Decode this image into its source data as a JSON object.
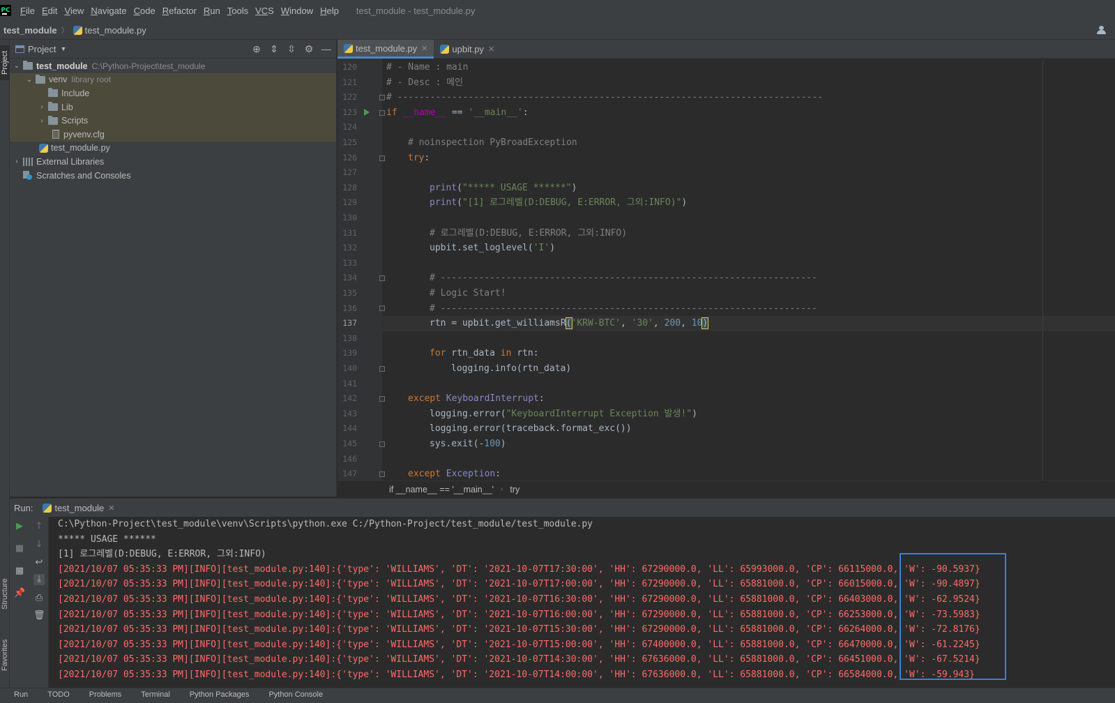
{
  "menu": {
    "logo": "PC",
    "items": [
      {
        "key": "F",
        "rest": "ile"
      },
      {
        "key": "E",
        "rest": "dit"
      },
      {
        "key": "V",
        "rest": "iew"
      },
      {
        "key": "N",
        "rest": "avigate"
      },
      {
        "key": "C",
        "rest": "ode"
      },
      {
        "key": "R",
        "rest": "efactor"
      },
      {
        "key": "R",
        "rest": "un"
      },
      {
        "key": "T",
        "rest": "ools"
      },
      {
        "key": "VC",
        "rest": "S"
      },
      {
        "key": "W",
        "rest": "indow"
      },
      {
        "key": "H",
        "rest": "elp"
      }
    ],
    "window_title": "test_module - test_module.py"
  },
  "nav": {
    "root": "test_module",
    "file": "test_module.py"
  },
  "left_strip": {
    "project": "Project",
    "structure": "Structure",
    "favorites": "Favorites"
  },
  "project": {
    "title": "Project",
    "tree": {
      "root": {
        "name": "test_module",
        "path": "C:\\Python-Project\\test_module"
      },
      "venv": {
        "name": "venv",
        "note": "library root"
      },
      "include": "Include",
      "lib": "Lib",
      "scripts": "Scripts",
      "cfg": "pyvenv.cfg",
      "main_file": "test_module.py",
      "ext_libs": "External Libraries",
      "scratches": "Scratches and Consoles"
    }
  },
  "editor": {
    "tabs": [
      {
        "label": "test_module.py"
      },
      {
        "label": "upbit.py"
      }
    ],
    "lines": [
      "120",
      "121",
      "122",
      "123",
      "124",
      "125",
      "126",
      "127",
      "128",
      "129",
      "130",
      "131",
      "132",
      "133",
      "134",
      "135",
      "136",
      "137",
      "138",
      "139",
      "140",
      "141",
      "142",
      "143",
      "144",
      "145",
      "146",
      "147"
    ],
    "current_line": "137",
    "code": {
      "l120": "# - Name : main",
      "l121": "# - Desc : 메인",
      "l122": "# ------------------------------------------------------------------------------",
      "l123_kw": "if",
      "l123_name": "__name__",
      "l123_op": " == ",
      "l123_str": "'__main__'",
      "l123_end": ":",
      "l125": "# noinspection PyBroadException",
      "l126": "try",
      "l128_fn": "print",
      "l128_str": "\"***** USAGE ******\"",
      "l129_fn": "print",
      "l129_str": "\"[1] 로그레벨(D:DEBUG, E:ERROR, 그외:INFO)\"",
      "l131": "# 로그레벨(D:DEBUG, E:ERROR, 그외:INFO)",
      "l132_a": "upbit.set_loglevel(",
      "l132_str": "'I'",
      "l134": "# ---------------------------------------------------------------------",
      "l135": "# Logic Start!",
      "l136": "# ---------------------------------------------------------------------",
      "l137_a": "rtn = upbit.get_williamsR",
      "l137_s1": "'KRW-BTC'",
      "l137_s2": "'30'",
      "l137_n1": "200",
      "l137_n2": "10",
      "l139_kw1": "for",
      "l139_mid": " rtn_data ",
      "l139_kw2": "in",
      "l139_end": " rtn:",
      "l140": "logging.info(rtn_data)",
      "l142_kw": "except",
      "l142_cls": "KeyboardInterrupt",
      "l143_a": "logging.error(",
      "l143_str": "\"KeyboardInterrupt Exception 발생!\"",
      "l144": "logging.error(traceback.format_exc())",
      "l145_a": "sys.exit(-",
      "l145_num": "100",
      "l147_kw": "except",
      "l147_cls": "Exception"
    },
    "breadcrumb": [
      "if __name__ == '__main__'",
      "try"
    ]
  },
  "run": {
    "label": "Run:",
    "tab": "test_module",
    "output": {
      "cmd": "C:\\Python-Project\\test_module\\venv\\Scripts\\python.exe C:/Python-Project/test_module/test_module.py",
      "usage": "***** USAGE ******",
      "loglevel": "[1] 로그레벨(D:DEBUG, E:ERROR, 그외:INFO)",
      "logs": [
        "[2021/10/07 05:35:33 PM][INFO][test_module.py:140]:{'type': 'WILLIAMS', 'DT': '2021-10-07T17:30:00', 'HH': 67290000.0, 'LL': 65993000.0, 'CP': 66115000.0, 'W': -90.5937}",
        "[2021/10/07 05:35:33 PM][INFO][test_module.py:140]:{'type': 'WILLIAMS', 'DT': '2021-10-07T17:00:00', 'HH': 67290000.0, 'LL': 65881000.0, 'CP': 66015000.0, 'W': -90.4897}",
        "[2021/10/07 05:35:33 PM][INFO][test_module.py:140]:{'type': 'WILLIAMS', 'DT': '2021-10-07T16:30:00', 'HH': 67290000.0, 'LL': 65881000.0, 'CP': 66403000.0, 'W': -62.9524}",
        "[2021/10/07 05:35:33 PM][INFO][test_module.py:140]:{'type': 'WILLIAMS', 'DT': '2021-10-07T16:00:00', 'HH': 67290000.0, 'LL': 65881000.0, 'CP': 66253000.0, 'W': -73.5983}",
        "[2021/10/07 05:35:33 PM][INFO][test_module.py:140]:{'type': 'WILLIAMS', 'DT': '2021-10-07T15:30:00', 'HH': 67290000.0, 'LL': 65881000.0, 'CP': 66264000.0, 'W': -72.8176}",
        "[2021/10/07 05:35:33 PM][INFO][test_module.py:140]:{'type': 'WILLIAMS', 'DT': '2021-10-07T15:00:00', 'HH': 67400000.0, 'LL': 65881000.0, 'CP': 66470000.0, 'W': -61.2245}",
        "[2021/10/07 05:35:33 PM][INFO][test_module.py:140]:{'type': 'WILLIAMS', 'DT': '2021-10-07T14:30:00', 'HH': 67636000.0, 'LL': 65881000.0, 'CP': 66451000.0, 'W': -67.5214}",
        "[2021/10/07 05:35:33 PM][INFO][test_module.py:140]:{'type': 'WILLIAMS', 'DT': '2021-10-07T14:00:00', 'HH': 67636000.0, 'LL': 65881000.0, 'CP': 66584000.0, 'W': -59.943}"
      ]
    }
  },
  "status": [
    "Run",
    "TODO",
    "Problems",
    "Terminal",
    "Python Packages",
    "Python Console"
  ],
  "colors": {
    "accent": "#4a88c7",
    "highlight_box": "#3d7fd6",
    "error_text": "#ff6b68",
    "run_arrow": "#499c54"
  }
}
